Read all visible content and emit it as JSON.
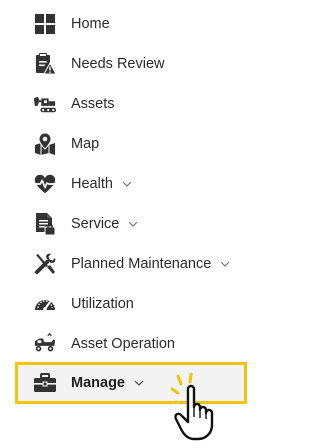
{
  "nav": {
    "items": [
      {
        "label": "Home",
        "icon": "grid-icon",
        "has_submenu": false
      },
      {
        "label": "Needs Review",
        "icon": "clipboard-alert-icon",
        "has_submenu": false
      },
      {
        "label": "Assets",
        "icon": "excavator-icon",
        "has_submenu": false
      },
      {
        "label": "Map",
        "icon": "map-pin-icon",
        "has_submenu": false
      },
      {
        "label": "Health",
        "icon": "heartbeat-icon",
        "has_submenu": true
      },
      {
        "label": "Service",
        "icon": "document-icon",
        "has_submenu": true
      },
      {
        "label": "Planned Maintenance",
        "icon": "wrench-screwdriver-icon",
        "has_submenu": true
      },
      {
        "label": "Utilization",
        "icon": "gauge-icon",
        "has_submenu": false
      },
      {
        "label": "Asset Operation",
        "icon": "truck-icon",
        "has_submenu": false
      },
      {
        "label": "Manage",
        "icon": "briefcase-icon",
        "has_submenu": true,
        "selected": true
      }
    ]
  },
  "colors": {
    "text": "#2b2b2b",
    "icon": "#333333",
    "highlight_border": "#f1c40f",
    "highlight_bg": "#f3f3f3",
    "cursor_accent": "#f1c40f"
  }
}
